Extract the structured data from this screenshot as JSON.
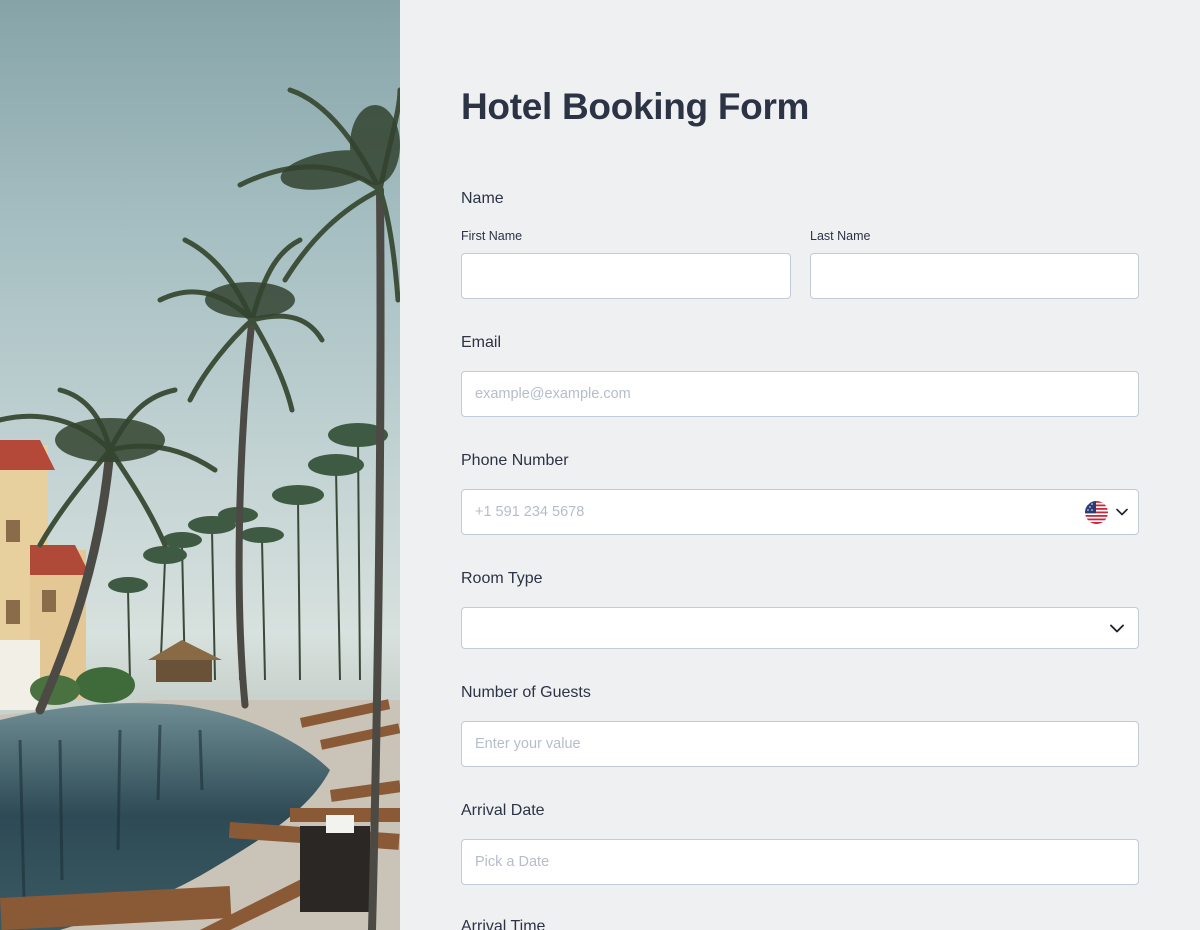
{
  "form": {
    "title": "Hotel Booking Form",
    "name": {
      "label": "Name",
      "first_label": "First Name",
      "first_value": "",
      "last_label": "Last Name",
      "last_value": ""
    },
    "email": {
      "label": "Email",
      "placeholder": "example@example.com",
      "value": ""
    },
    "phone": {
      "label": "Phone Number",
      "placeholder": "+1 591 234 5678",
      "country_icon": "us-flag-icon",
      "value": ""
    },
    "room_type": {
      "label": "Room Type",
      "selected": ""
    },
    "guests": {
      "label": "Number of Guests",
      "placeholder": "Enter your value",
      "value": ""
    },
    "arrival_date": {
      "label": "Arrival Date",
      "placeholder": "Pick a Date",
      "value": ""
    },
    "arrival_time": {
      "label": "Arrival Time"
    }
  },
  "colors": {
    "page_bg": "#eff0f2",
    "text": "#2c3345",
    "placeholder": "#b6bdca",
    "input_border": "#c3cad8"
  }
}
